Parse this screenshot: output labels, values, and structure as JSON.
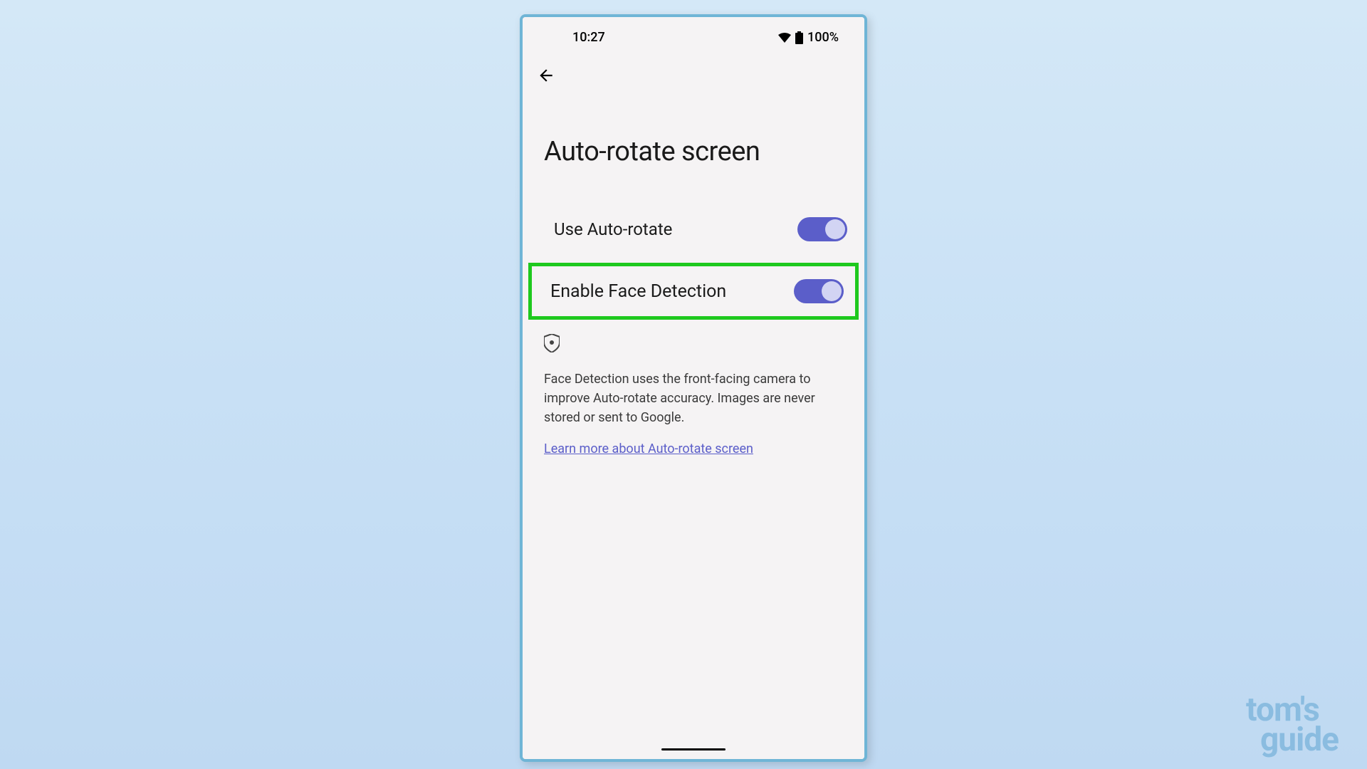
{
  "status_bar": {
    "time": "10:27",
    "battery": "100%"
  },
  "page": {
    "title": "Auto-rotate screen"
  },
  "settings": {
    "auto_rotate": {
      "label": "Use Auto-rotate",
      "enabled": true
    },
    "face_detection": {
      "label": "Enable Face Detection",
      "enabled": true,
      "highlighted": true
    }
  },
  "privacy": {
    "description": "Face Detection uses the front-facing camera to improve Auto-rotate accuracy. Images are never stored or sent to Google.",
    "learn_more": "Learn more about Auto-rotate screen"
  },
  "watermark": {
    "line1": "tom's",
    "line2": "guide"
  }
}
